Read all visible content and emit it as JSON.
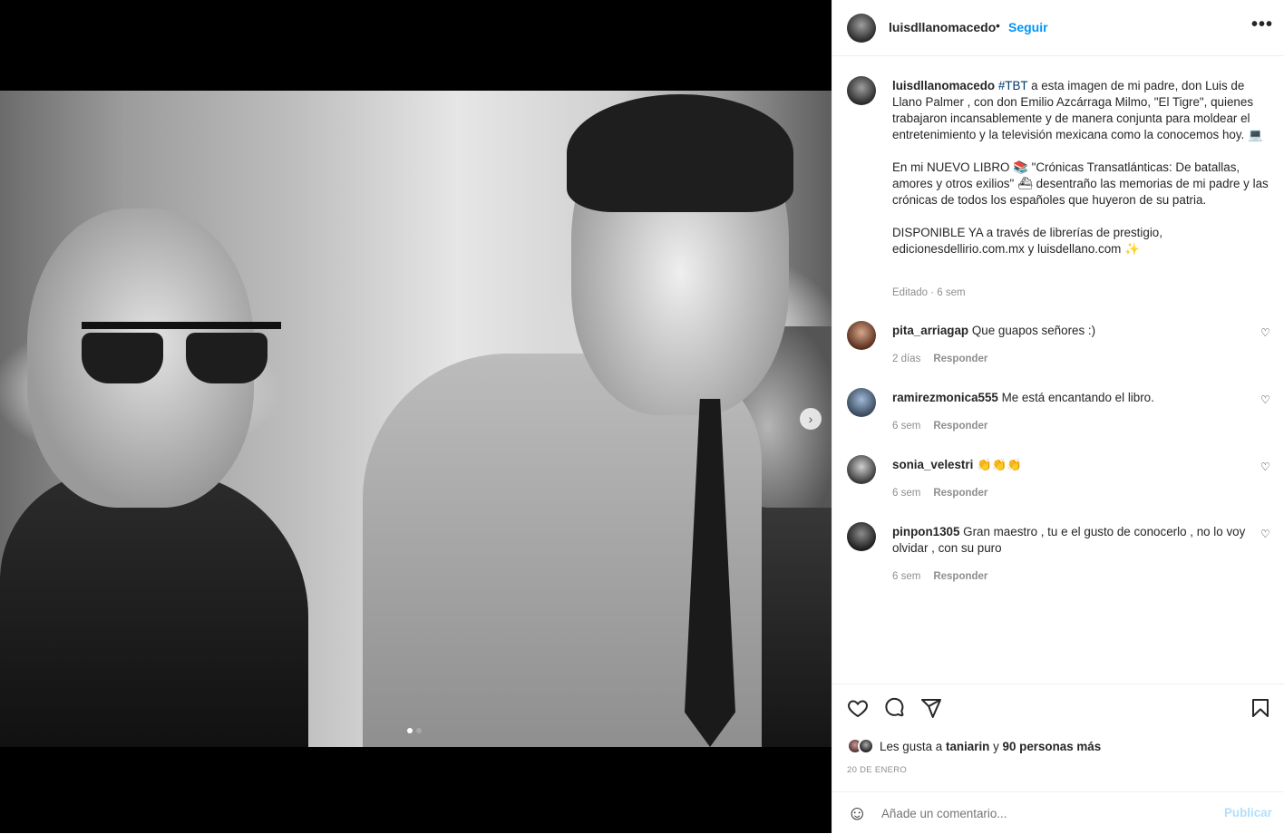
{
  "post": {
    "username": "luisdllanomacedo",
    "follow_label": "Seguir",
    "separator": "•",
    "more_icon": "more-dots-icon"
  },
  "media": {
    "next_icon": "chevron-right-icon",
    "next_glyph": "›",
    "slide_index": 1,
    "slide_count": 2
  },
  "caption": {
    "username": "luisdllanomacedo",
    "hashtag": "#TBT",
    "para1": " a esta imagen de mi padre, don Luis de Llano Palmer , con don Emilio Azcárraga Milmo, \"El Tigre\", quienes trabajaron incansablemente y de manera conjunta para moldear el entretenimiento y la televisión mexicana como la conocemos hoy. 💻",
    "para2": "En mi NUEVO LIBRO 📚 \"Crónicas Transatlánticas: De batallas, amores y otros exilios\" ⛴ desentraño las memorias de mi padre y las crónicas de todos los españoles que huyeron de su patria.",
    "para3": "DISPONIBLE YA a través de librerías de prestigio, edicionesdellirio.com.mx y luisdellano.com ✨",
    "meta": "Editado · 6 sem"
  },
  "comments": [
    {
      "username": "pita_arriagap",
      "text": "Que guapos señores :)",
      "time": "2 días",
      "reply": "Responder"
    },
    {
      "username": "ramirezmonica555",
      "text": "Me está encantando el libro.",
      "time": "6 sem",
      "reply": "Responder"
    },
    {
      "username": "sonia_velestri",
      "text": "👏👏👏",
      "time": "6 sem",
      "reply": "Responder"
    },
    {
      "username": "pinpon1305",
      "text": "Gran maestro , tu e el gusto de conocerlo , no lo voy olvidar , con su puro",
      "time": "6 sem",
      "reply": "Responder"
    }
  ],
  "actions": {
    "like_icon": "heart-icon",
    "comment_icon": "comment-bubble-icon",
    "share_icon": "paper-plane-icon",
    "save_icon": "bookmark-icon"
  },
  "likes": {
    "prefix": "Les gusta a",
    "user": "taniarin",
    "middle": "y",
    "others": "90 personas más"
  },
  "date": "20 DE ENERO",
  "add_comment": {
    "emoji_icon": "emoji-smile-icon",
    "emoji_glyph": "☺",
    "placeholder": "Añade un comentario...",
    "publish_label": "Publicar"
  },
  "colors": {
    "accent": "#0095f6",
    "link": "#00376b",
    "muted": "#8e8e8e",
    "publish_disabled": "#b2dffc"
  }
}
